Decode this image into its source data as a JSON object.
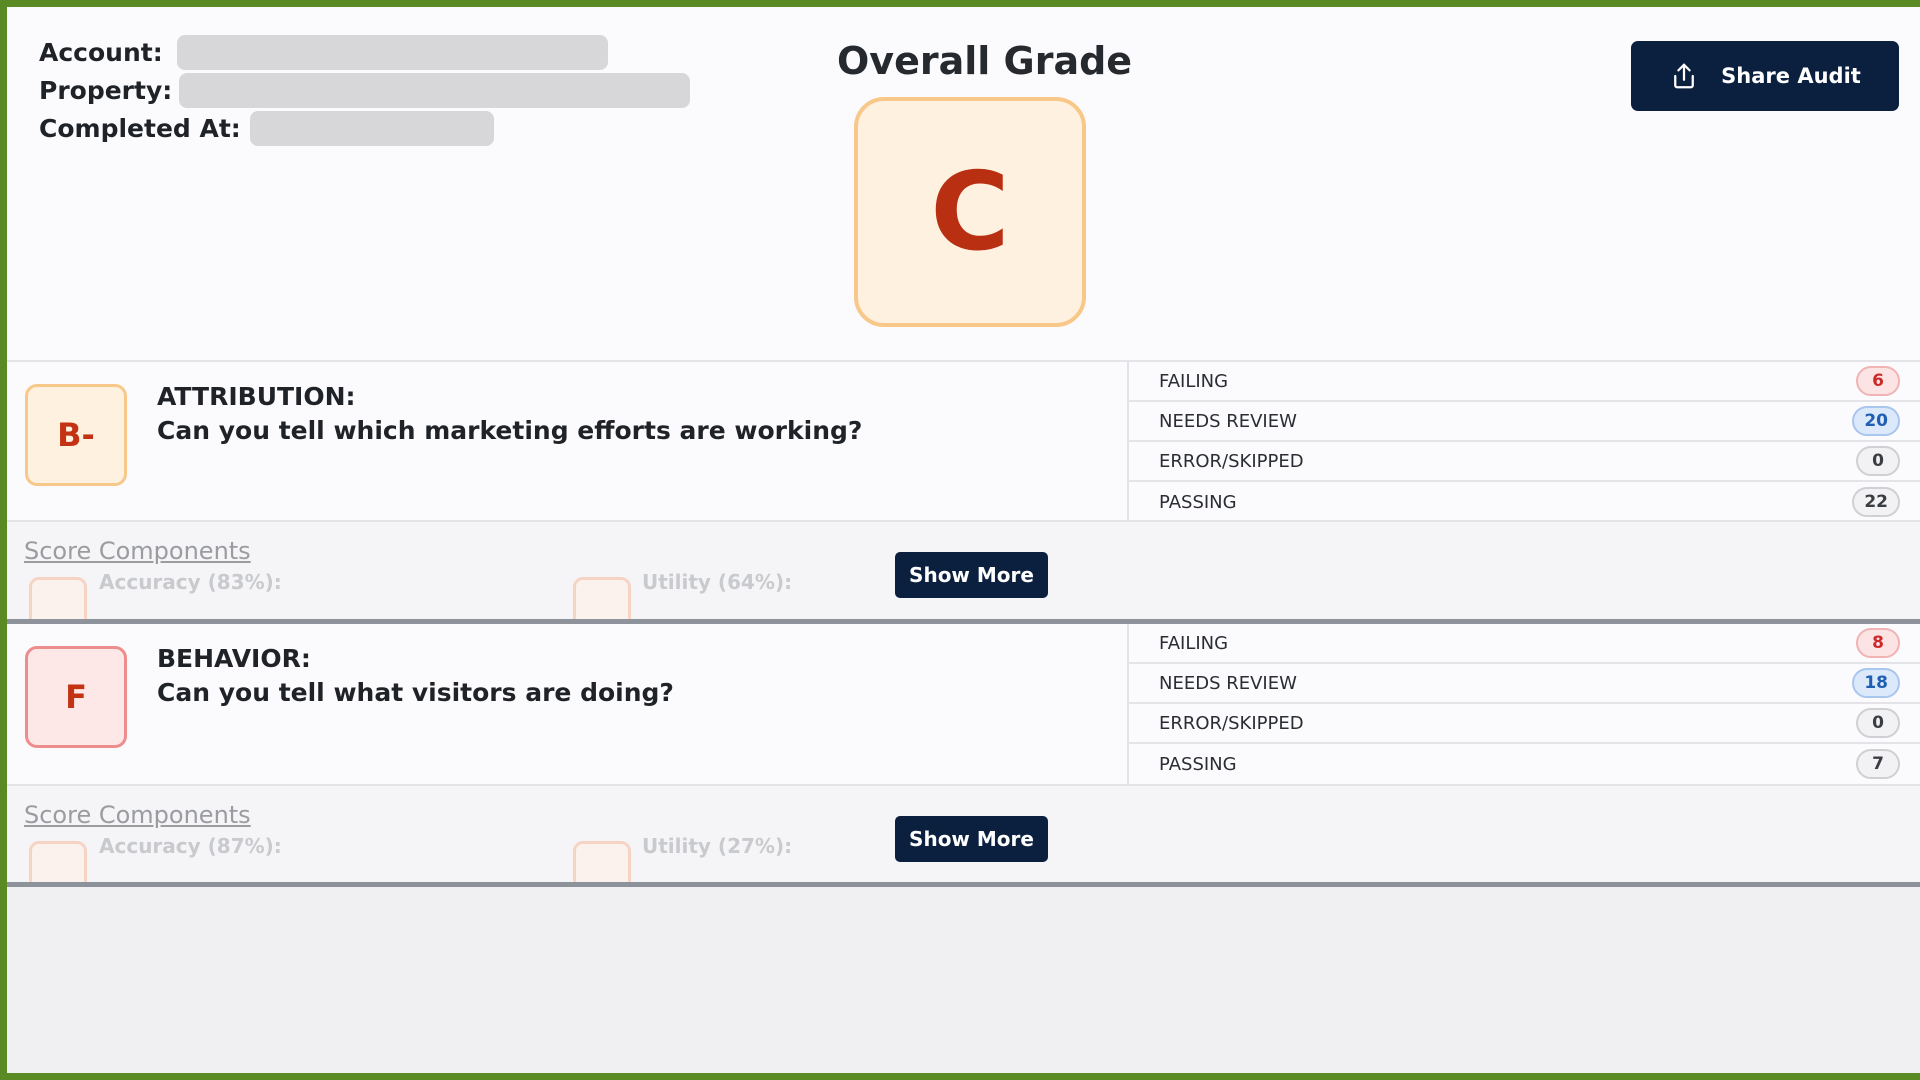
{
  "header": {
    "account_label": "Account:",
    "property_label": "Property:",
    "completed_label": "Completed At:",
    "overall_title": "Overall Grade",
    "overall_grade": "C",
    "share_label": "Share Audit"
  },
  "sections": [
    {
      "grade": "B-",
      "title": "ATTRIBUTION:",
      "question": "Can you tell which marketing efforts are working?",
      "stats": [
        {
          "label": "FAILING",
          "count": "6"
        },
        {
          "label": "NEEDS REVIEW",
          "count": "20"
        },
        {
          "label": "ERROR/SKIPPED",
          "count": "0"
        },
        {
          "label": "PASSING",
          "count": "22"
        }
      ],
      "score_components_label": "Score Components",
      "accuracy_label": "Accuracy (83%):",
      "utility_label": "Utility (64%):",
      "show_more_label": "Show More"
    },
    {
      "grade": "F",
      "title": "BEHAVIOR:",
      "question": "Can you tell what visitors are doing?",
      "stats": [
        {
          "label": "FAILING",
          "count": "8"
        },
        {
          "label": "NEEDS REVIEW",
          "count": "18"
        },
        {
          "label": "ERROR/SKIPPED",
          "count": "0"
        },
        {
          "label": "PASSING",
          "count": "7"
        }
      ],
      "score_components_label": "Score Components",
      "accuracy_label": "Accuracy (87%):",
      "utility_label": "Utility (27%):",
      "show_more_label": "Show More"
    }
  ],
  "colors": {
    "border_green": "#5a8a23",
    "navy": "#0b1f3f",
    "grade_red": "#c33213",
    "grade_orange_border": "#f7c889"
  },
  "icons": {
    "share": "share-upload-icon"
  }
}
